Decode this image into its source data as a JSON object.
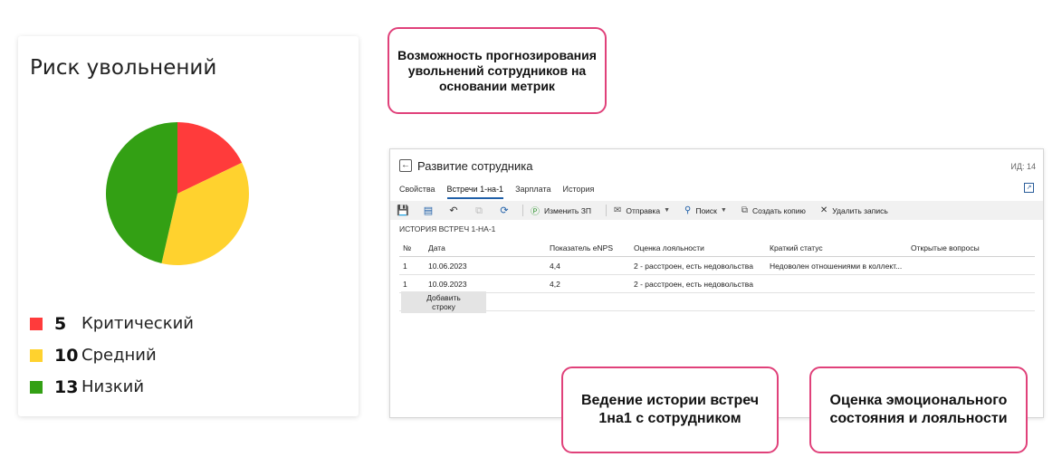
{
  "risk_card": {
    "title": "Риск увольнений",
    "legend": [
      {
        "count": "5",
        "label": "Критический",
        "color": "#ff3b3b"
      },
      {
        "count": "10",
        "label": "Средний",
        "color": "#ffd22e"
      },
      {
        "count": "13",
        "label": "Низкий",
        "color": "#33a014"
      }
    ]
  },
  "chart_data": {
    "type": "pie",
    "categories": [
      "Критический",
      "Средний",
      "Низкий"
    ],
    "values": [
      5,
      10,
      13
    ],
    "colors": [
      "#ff3b3b",
      "#ffd22e",
      "#33a014"
    ],
    "title": "Риск увольнений",
    "legend_position": "bottom-left"
  },
  "callouts": {
    "top": "Возможность прогнозирования увольнений сотрудников на основании метрик",
    "bottom_left": "Ведение истории встреч 1на1 с сотрудником",
    "bottom_right": "Оценка эмоционального состояния и лояльности"
  },
  "window": {
    "title": "Развитие сотрудника",
    "id_label": "ИД: 14",
    "tabs": [
      {
        "label": "Свойства",
        "active": false
      },
      {
        "label": "Встречи 1-на-1",
        "active": true
      },
      {
        "label": "Зарплата",
        "active": false
      },
      {
        "label": "История",
        "active": false
      }
    ],
    "toolbar": {
      "change_salary": "Изменить ЗП",
      "send": "Отправка",
      "search": "Поиск",
      "copy": "Создать копию",
      "delete": "Удалить запись"
    },
    "section_title": "ИСТОРИЯ ВСТРЕЧ 1-НА-1",
    "table": {
      "headers": [
        "№",
        "Дата",
        "Показатель eNPS",
        "Оценка лояльности",
        "Краткий статус",
        "Открытые вопросы"
      ],
      "rows": [
        [
          "1",
          "10.06.2023",
          "4,4",
          "2 - расстроен, есть недовольства",
          "Недоволен отношениями в коллект...",
          ""
        ],
        [
          "1",
          "10.09.2023",
          "4,2",
          "2 - расстроен, есть недовольства",
          "",
          ""
        ]
      ]
    },
    "add_row_label": "Добавить строку"
  }
}
